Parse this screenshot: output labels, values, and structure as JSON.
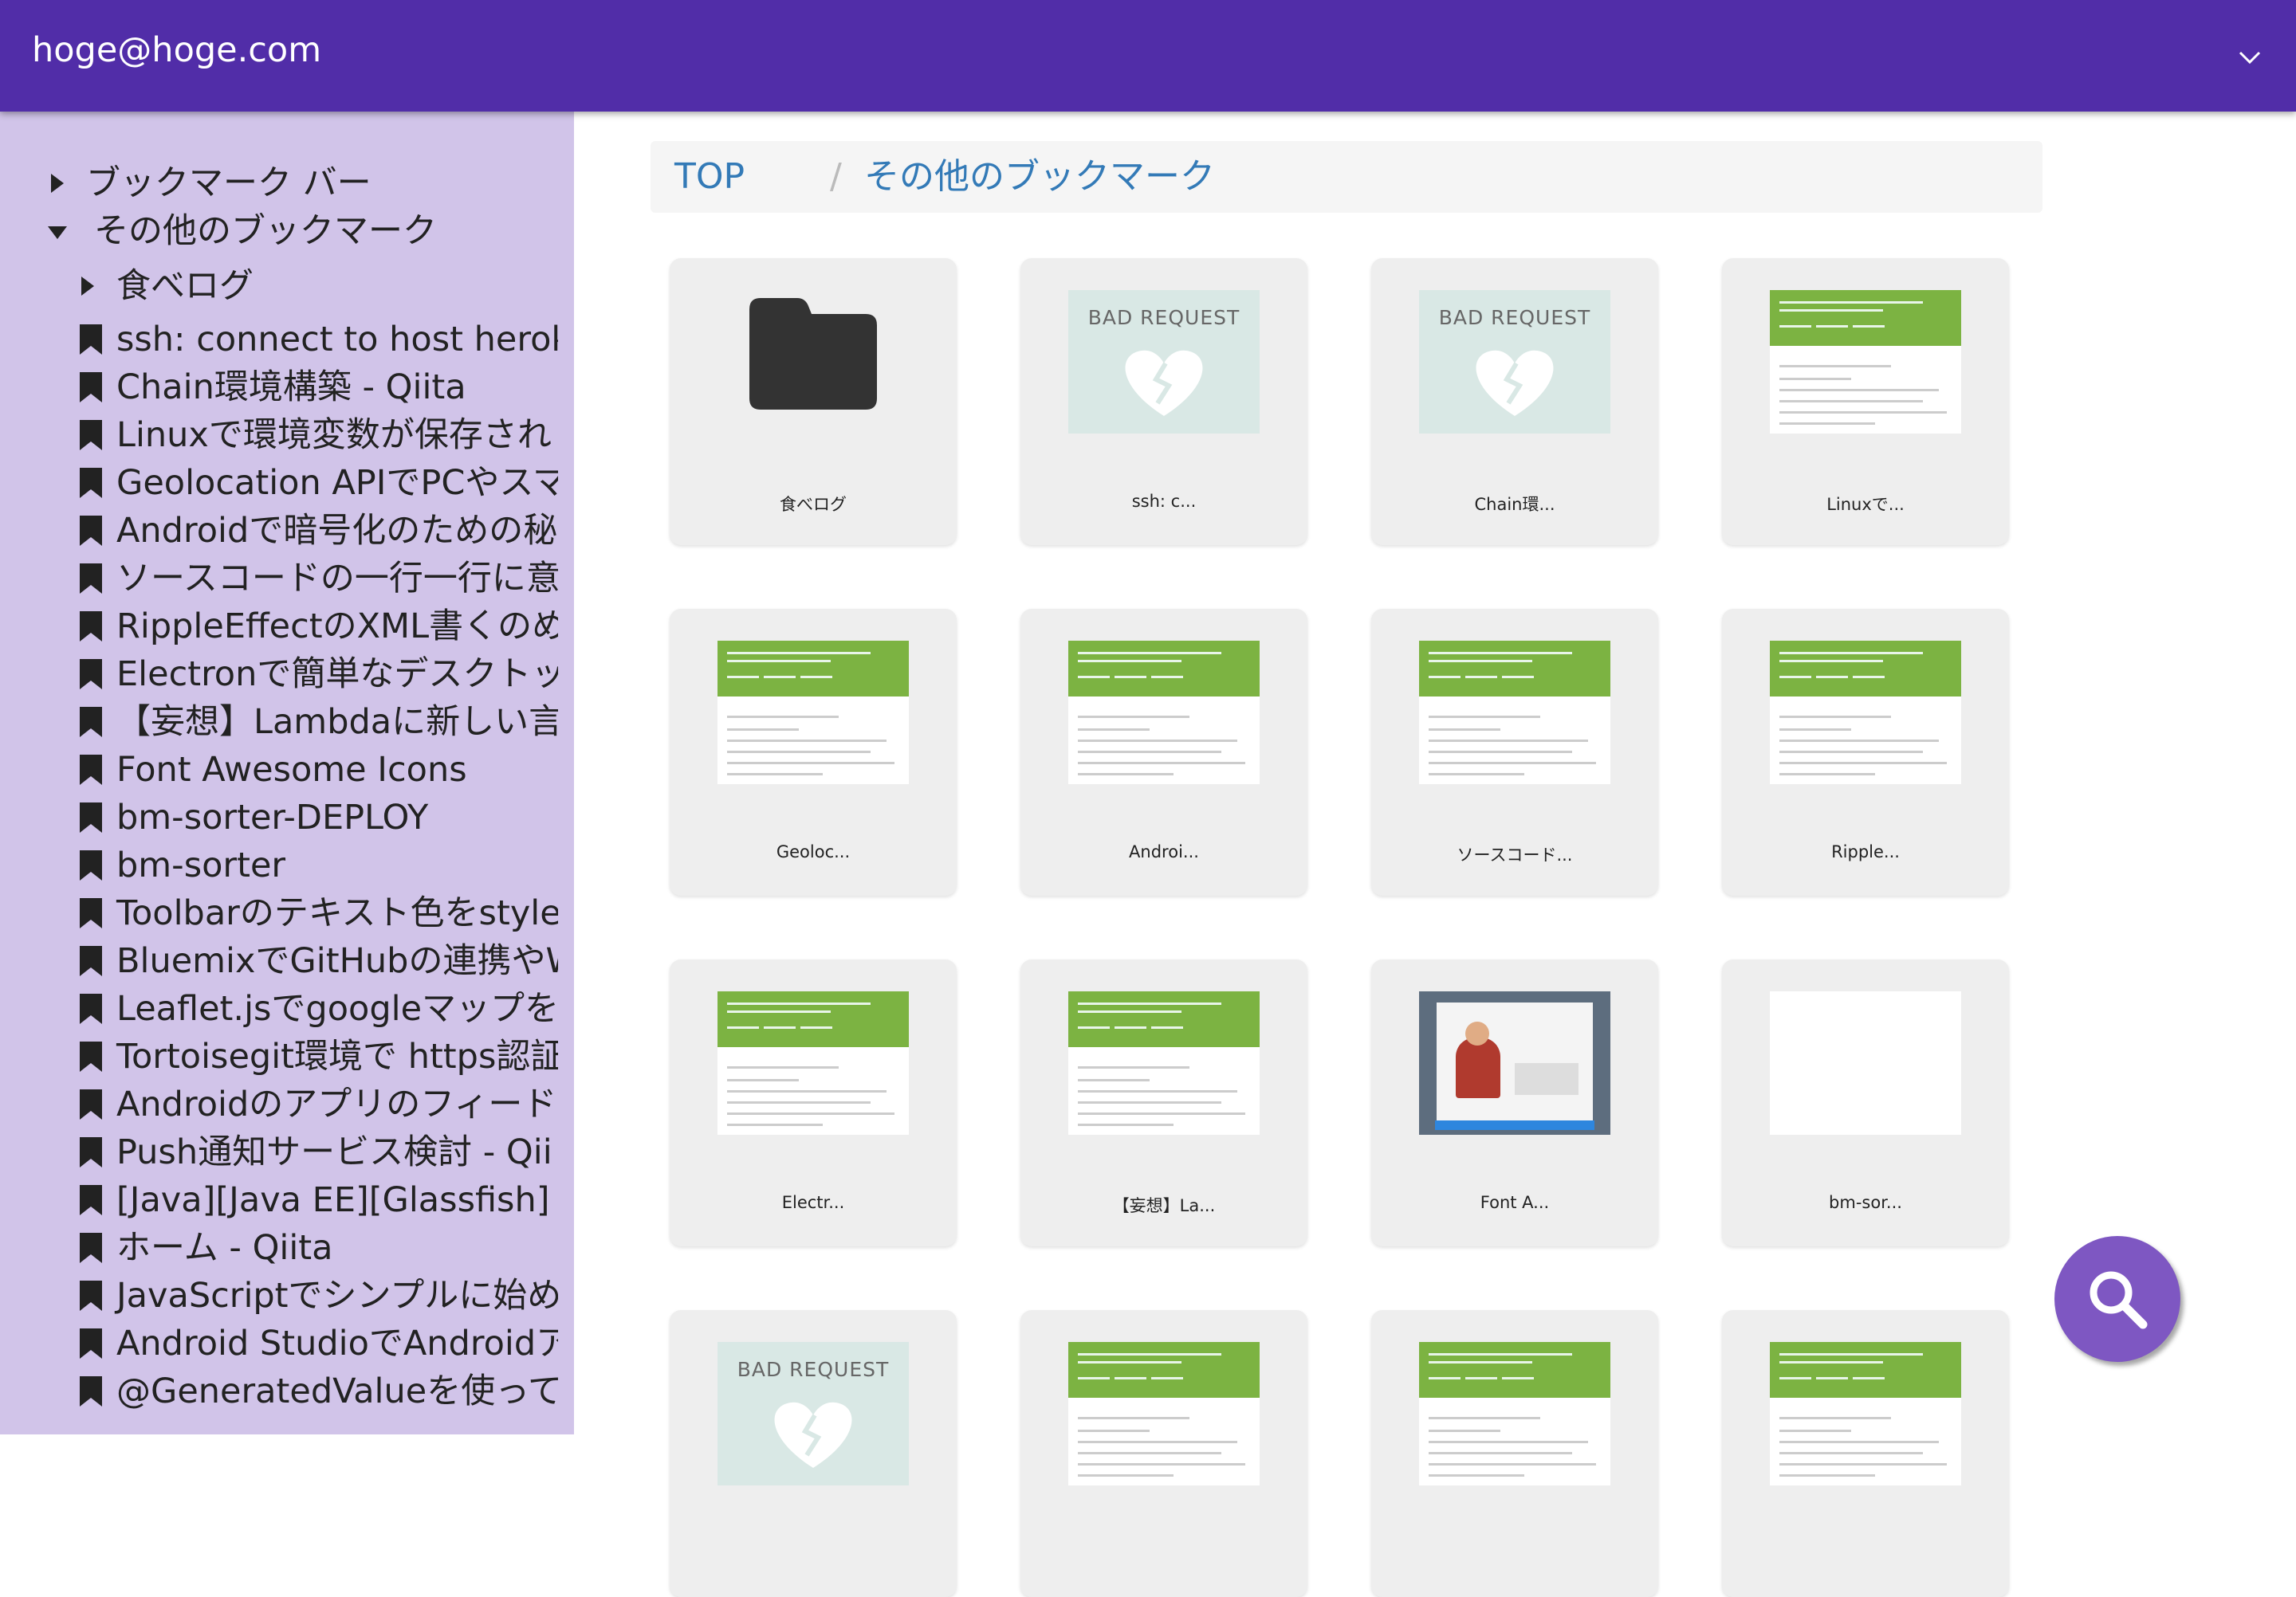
{
  "header": {
    "user_email": "hoge@hoge.com",
    "dropdown_icon": "chevron-down-icon"
  },
  "sidebar": {
    "folders": [
      {
        "label": "ブックマーク バー",
        "expanded": false
      },
      {
        "label": "その他のブックマーク",
        "expanded": true
      },
      {
        "label": "食べログ",
        "expanded": false
      }
    ],
    "bookmarks": [
      "ssh: connect to host herok",
      "Chain環境構築 - Qiita",
      "Linuxで環境変数が保存され",
      "Geolocation APIでPCやスマ",
      "Androidで暗号化のための秘",
      "ソースコードの一行一行に意",
      "RippleEffectのXML書くのめ",
      "Electronで簡単なデスクトッ",
      "【妄想】Lambdaに新しい言",
      "Font Awesome Icons",
      "bm-sorter-DEPLOY",
      "bm-sorter",
      "Toolbarのテキスト色をstyle",
      "BluemixでGitHubの連携やW",
      "Leaflet.jsでgoogleマップを",
      "Tortoisegit環境で https認証",
      "Androidのアプリのフィード",
      "Push通知サービス検討 - Qii",
      "[Java][Java EE][Glassfish]",
      "ホーム - Qiita",
      "JavaScriptでシンプルに始め",
      "Android StudioでAndroidア",
      "@GeneratedValueを使ってエ"
    ]
  },
  "breadcrumb": {
    "top": "TOP",
    "separator": "/",
    "current": "その他のブックマーク"
  },
  "cards": [
    {
      "title": "食べログ",
      "kind": "folder"
    },
    {
      "title": "ssh: c...",
      "kind": "bad",
      "thumb_text": "BAD REQUEST"
    },
    {
      "title": "Chain環...",
      "kind": "bad",
      "thumb_text": "BAD REQUEST"
    },
    {
      "title": "Linuxで...",
      "kind": "qiita"
    },
    {
      "title": "Geoloc...",
      "kind": "qiita"
    },
    {
      "title": "Androi...",
      "kind": "qiita"
    },
    {
      "title": "ソースコード...",
      "kind": "qiita"
    },
    {
      "title": "Ripple...",
      "kind": "qiita"
    },
    {
      "title": "Electr...",
      "kind": "qiita"
    },
    {
      "title": "【妄想】La...",
      "kind": "qiita"
    },
    {
      "title": "Font A...",
      "kind": "fa"
    },
    {
      "title": "bm-sor...",
      "kind": "blank"
    },
    {
      "title": "",
      "kind": "bad",
      "thumb_text": "BAD REQUEST"
    },
    {
      "title": "",
      "kind": "qiita"
    },
    {
      "title": "",
      "kind": "qiita"
    },
    {
      "title": "",
      "kind": "qiita"
    }
  ],
  "fab": {
    "icon": "search-icon"
  },
  "colors": {
    "header": "#512da8",
    "sidebar": "#d1c4e9",
    "link": "#337ab7",
    "fab": "#7e57c2"
  }
}
